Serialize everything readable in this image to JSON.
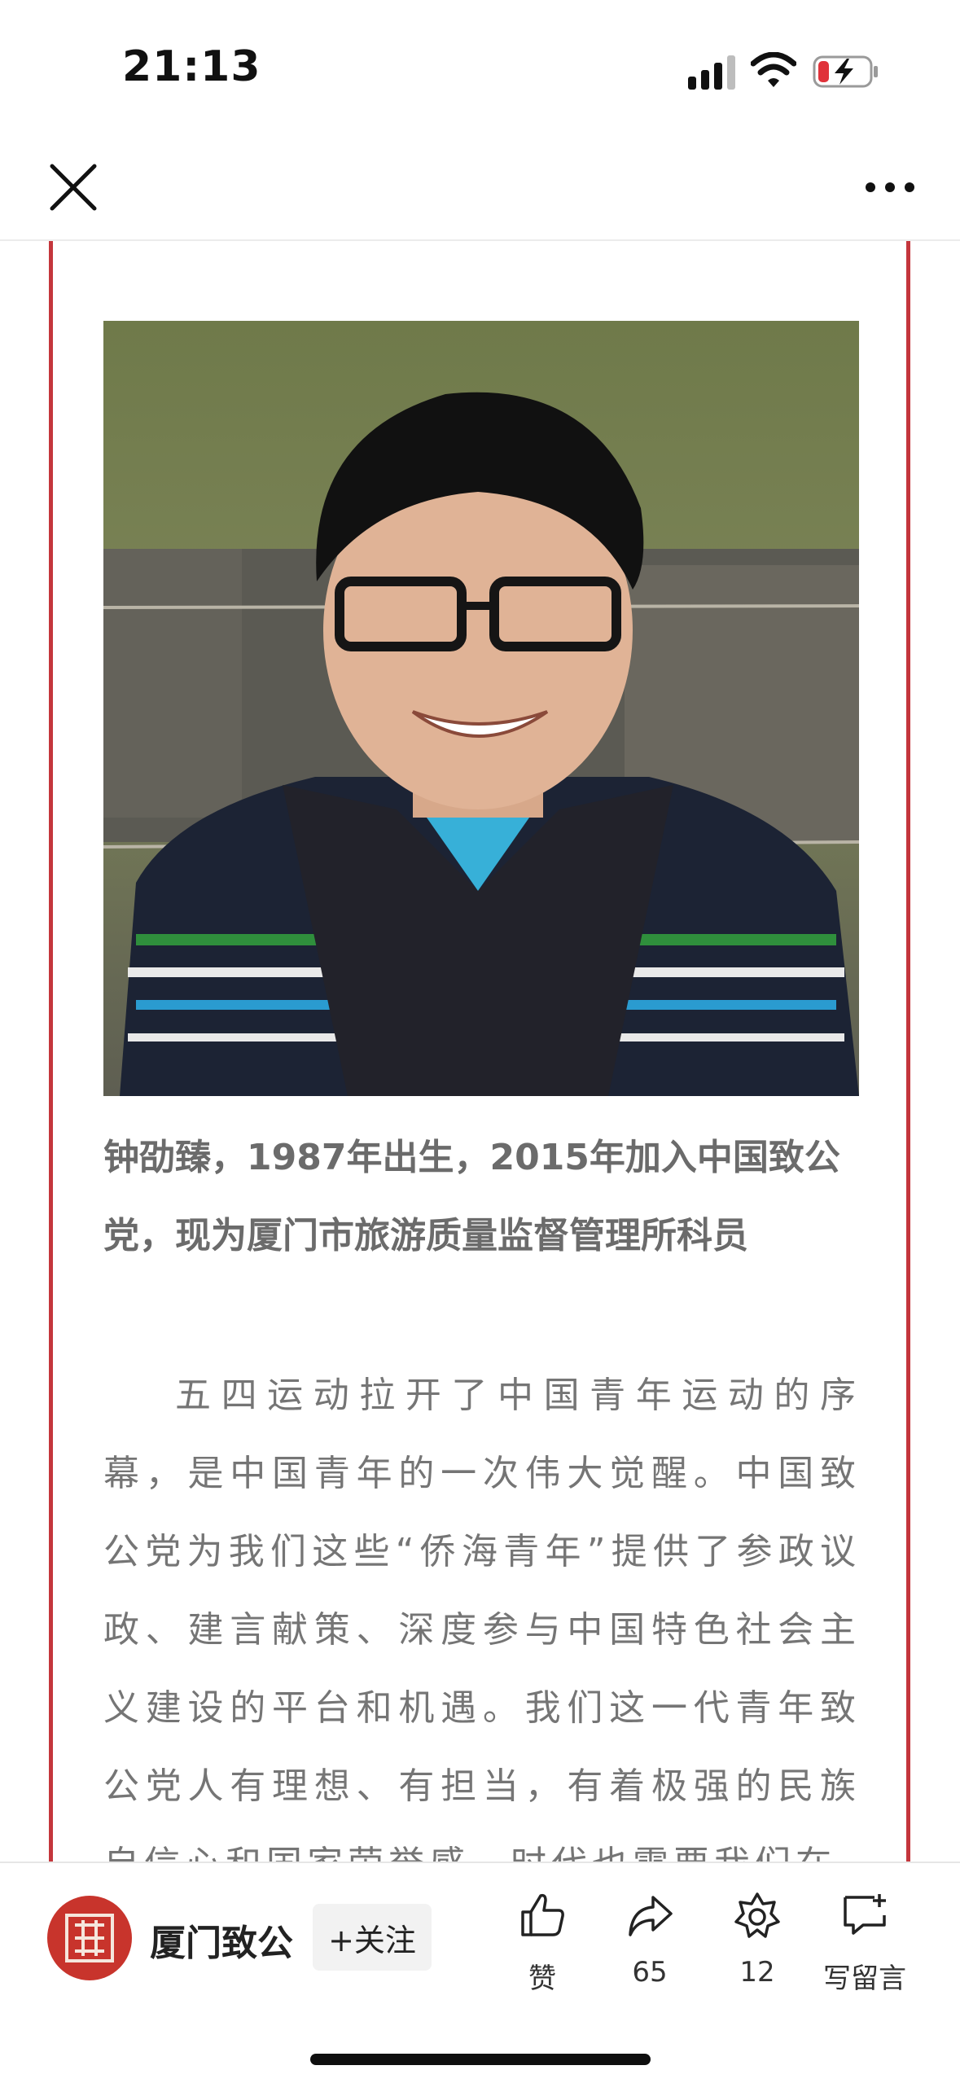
{
  "status_bar": {
    "time": "21:13"
  },
  "nav": {
    "close_icon": "close-icon",
    "more_icon": "more-dots-icon"
  },
  "article": {
    "caption": "钟劭臻，1987年出生，2015年加入中国致公党，现为厦门市旅游质量监督管理所科员",
    "body": "五四运动拉开了中国青年运动的序幕，是中国青年的一次伟大觉醒。中国致公党为我们这些“侨海青年”提供了参政议政、建言献策、深度参与中国特色社会主义建设的平台和机遇。我们这一代青年致公党人有理想、有担当，有着极强的民族自信心和国家荣誉感，时代也需要我们在"
  },
  "bottom_bar": {
    "account_name": "厦门致公",
    "follow_label": "+关注",
    "actions": [
      {
        "icon": "thumbs-up-icon",
        "label": "赞"
      },
      {
        "icon": "share-icon",
        "label": "65"
      },
      {
        "icon": "wow-icon",
        "label": "12"
      },
      {
        "icon": "comment-icon",
        "label": "写留言"
      }
    ]
  },
  "colors": {
    "frame_red": "#c4363c",
    "avatar_red": "#c8342c"
  }
}
